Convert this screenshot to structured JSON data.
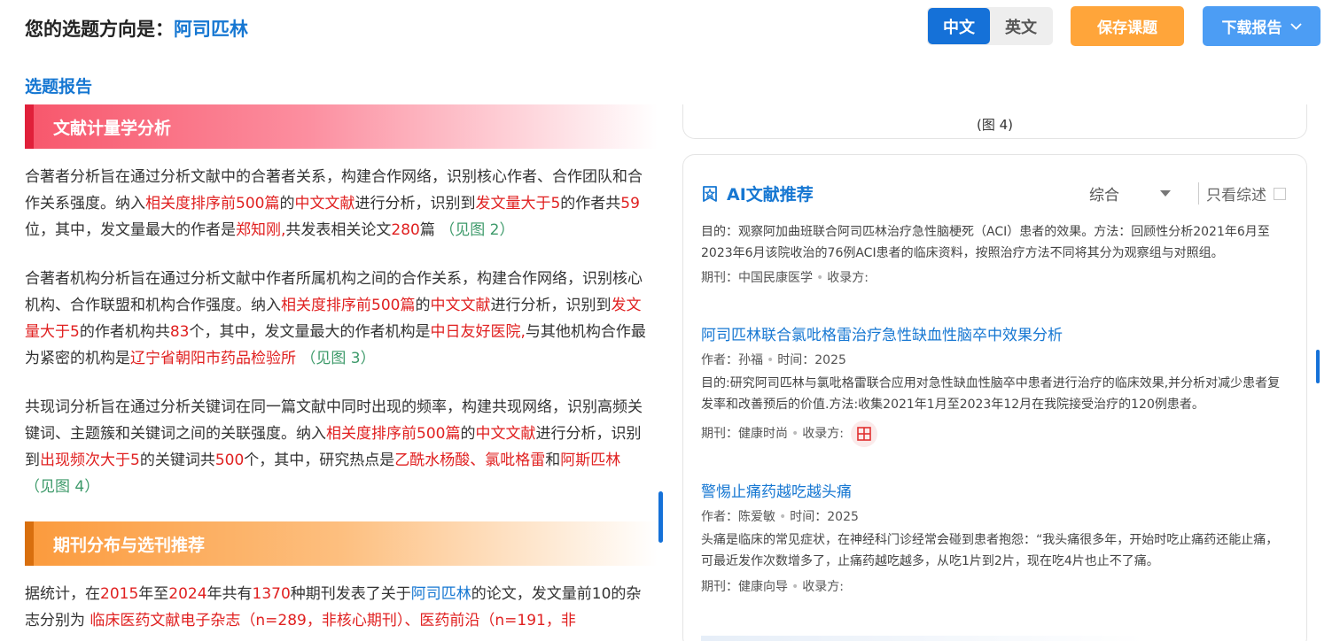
{
  "header": {
    "prefix": "您的选题方向是：",
    "topic": "阿司匹林",
    "lang_zh": "中文",
    "lang_en": "英文",
    "save_label": "保存课题",
    "download_label": "下载报告"
  },
  "report_label": "选题报告",
  "sections": {
    "bibliometrics": {
      "title": "文献计量学分析",
      "p1": {
        "t1": "合著者分析旨在通过分析文献中的合著者关系，构建合作网络，识别核心作者、合作团队和合作关系强度。纳入",
        "h1": "相关度排序前500篇",
        "t2": "的",
        "h2": "中文文献",
        "t3": "进行分析，识别到",
        "h3": "发文量大于5",
        "t4": "的作者共",
        "h4": "59",
        "t5": "位，其中，发文量最大的作者是",
        "h5": "郑知刚,",
        "t6": "共发表相关论文",
        "h6": "280",
        "t7": "篇 ",
        "ref": "（见图 2）"
      },
      "p2": {
        "t1": "合著者机构分析旨在通过分析文献中作者所属机构之间的合作关系，构建合作网络，识别核心机构、合作联盟和机构合作强度。纳入",
        "h1": "相关度排序前500篇",
        "t2": "的",
        "h2": "中文文献",
        "t3": "进行分析，识别到",
        "h3": "发文量大于5",
        "t4": "的作者机构共",
        "h4": "83",
        "t5": "个，其中，发文量最大的作者机构是",
        "h5": "中日友好医院,",
        "t6": "与其他机构合作最为紧密的机构是",
        "h6": "辽宁省朝阳市药品检验所",
        "ref": "（见图 3）"
      },
      "p3": {
        "t1": "共现词分析旨在通过分析关键词在同一篇文献中同时出现的频率，构建共现网络，识别高频关键词、主题簇和关键词之间的关联强度。纳入",
        "h1": "相关度排序前500篇",
        "t2": "的",
        "h2": "中文文献",
        "t3": "进行分析，识别到",
        "h3": "出现频次大于5",
        "t4": "的关键词共",
        "h4": "500",
        "t5": "个，其中，研究热点是",
        "h5": "乙酰水杨酸、氯吡格雷",
        "t6": "和",
        "h6": "阿斯匹林",
        "ref": "（见图 4）"
      }
    },
    "journals": {
      "title": "期刊分布与选刊推荐",
      "p1": {
        "t1": "据统计，在",
        "y1": "2015",
        "t2": "年至",
        "y2": "2024",
        "t3": "年共有",
        "n1": "1370",
        "t4": "种期刊发表了关于",
        "topic": "阿司匹林",
        "t5": "的论文，发文量前10的杂志分别为 ",
        "list": "临床医药文献电子杂志（n=289，非核心期刊）、医药前沿（n=191，非"
      }
    }
  },
  "figure_caption": "(图 4)",
  "ai_recommend": {
    "title": "AI文献推荐",
    "sort_value": "综合",
    "review_only_label": "只看综述",
    "items": [
      {
        "abstract": "目的：观察阿加曲班联合阿司匹林治疗急性脑梗死（ACI）患者的效果。方法：回顾性分析2021年6月至2023年6月该院收治的76例ACI患者的临床资料，按照治疗方法不同将其分为观察组与对照组。",
        "journal_label": "期刊：",
        "journal": "中国民康医学",
        "indexed_label": "收录方:"
      },
      {
        "title": "阿司匹林联合氯吡格雷治疗急性缺血性脑卒中效果分析",
        "author_label": "作者：",
        "author": "孙福",
        "time_label": "时间：",
        "time": "2025",
        "abstract": "目的:研究阿司匹林与氯吡格雷联合应用对急性缺血性脑卒中患者进行治疗的临床效果,并分析对减少患者复发率和改善预后的价值.方法:收集2021年1月至2023年12月在我院接受治疗的120例患者。",
        "journal_label": "期刊：",
        "journal": "健康时尚",
        "indexed_label": "收录方:"
      },
      {
        "title": "警惕止痛药越吃越头痛",
        "author_label": "作者：",
        "author": "陈爱敏",
        "time_label": "时间：",
        "time": "2025",
        "abstract": "头痛是临床的常见症状，在神经科门诊经常会碰到患者抱怨：“我头痛很多年，开始时吃止痛药还能止痛，可最近发作次数增多了，止痛药越吃越多，从吃1片到2片，现在吃4片也止不了痛。",
        "journal_label": "期刊：",
        "journal": "健康向导",
        "indexed_label": "收录方:"
      }
    ]
  },
  "colors": {
    "primary_blue": "#1677d2",
    "highlight_red": "#e02020",
    "reference_green": "#3d9a6a",
    "save_orange": "#ffa53a",
    "download_blue": "#4c9df4"
  }
}
